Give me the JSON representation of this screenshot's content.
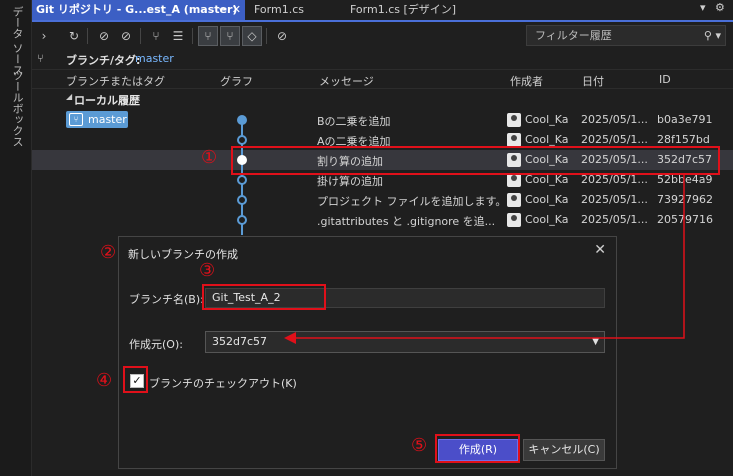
{
  "side_tabs": [
    "データ ソース",
    "ツールボックス"
  ],
  "tabs": [
    {
      "label": "Git リポジトリ - G...est_A (master)"
    },
    {
      "label": "Form1.cs"
    },
    {
      "label": "Form1.cs [デザイン]"
    }
  ],
  "toolbar": {
    "filter_placeholder": "フィルター履歴"
  },
  "branch": {
    "label": "ブランチ/タグ:",
    "value": "master"
  },
  "columns": {
    "branch_tag": "ブランチまたはタグ",
    "graph": "グラフ",
    "message": "メッセージ",
    "author": "作成者",
    "date": "日付",
    "id": "ID"
  },
  "group": {
    "label": "ローカル履歴"
  },
  "branch_pill": {
    "label": "master"
  },
  "commits": [
    {
      "message": "Bの二乗を追加",
      "author": "Cool_Ka",
      "date": "2025/05/1...",
      "id": "b0a3e791"
    },
    {
      "message": "Aの二乗を追加",
      "author": "Cool_Ka",
      "date": "2025/05/1...",
      "id": "28f157bd"
    },
    {
      "message": "割り算の追加",
      "author": "Cool_Ka",
      "date": "2025/05/1...",
      "id": "352d7c57"
    },
    {
      "message": "掛け算の追加",
      "author": "Cool_Ka",
      "date": "2025/05/1...",
      "id": "52bbe4a9"
    },
    {
      "message": "プロジェクト ファイルを追加します。",
      "author": "Cool_Ka",
      "date": "2025/05/1...",
      "id": "73927962"
    },
    {
      "message": ".gitattributes と .gitignore を追...",
      "author": "Cool_Ka",
      "date": "2025/05/1...",
      "id": "20579716"
    }
  ],
  "dialog": {
    "title": "新しいブランチの作成",
    "name_label": "ブランチ名(B):",
    "name_value": "Git_Test_A_2",
    "source_label": "作成元(O):",
    "source_value": "352d7c57",
    "checkout_label": "ブランチのチェックアウト(K)",
    "checkout_checked": true,
    "create_button": "作成(R)",
    "cancel_button": "キャンセル(C)"
  },
  "annotations": [
    "①",
    "②",
    "③",
    "④",
    "⑤"
  ],
  "colors": {
    "annotation": "#e0101a",
    "accent": "#3c5fc4",
    "graph": "#5b9bd5",
    "primary_button": "#4b4ec9"
  }
}
